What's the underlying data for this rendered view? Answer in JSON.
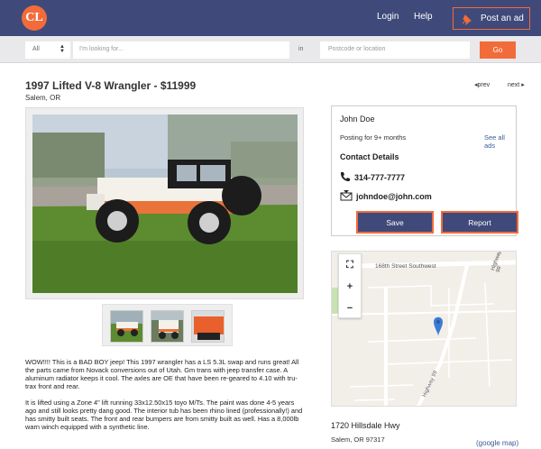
{
  "header": {
    "logo": "CL",
    "login": "Login",
    "help": "Help",
    "post_ad": "Post an ad"
  },
  "search": {
    "category": "All",
    "query_placeholder": "I'm looking for...",
    "in_label": "in",
    "location_placeholder": "Postcode or location",
    "go": "Go"
  },
  "listing": {
    "title": "1997 Lifted V-8 Wrangler - $11999",
    "location": "Salem, OR",
    "prev": "prev",
    "next": "next",
    "description_1": "WOW!!!! This is a BAD BOY jeep! This 1997 wrangler has a LS 5.3L swap and runs great! All the parts came from Novack conversions out of Utah. Gm trans with jeep transfer case. A aluminum radiator keeps it cool. The axles are OE that have been re-geared to 4.10 with tru-trax front and rear.",
    "description_2": "It is lifted using a Zone 4\" lift running 33x12.50x15 toyo M/Ts. The paint was done 4-5 years ago and still looks pretty dang good. The interior tub has been rhino lined (professionally!) and has smitty built seats. The front and rear bumpers are from smitty built as well. Has a 8,000lb warn winch equipped with a synthetic line."
  },
  "seller": {
    "name": "John Doe",
    "since": "Posting for 9+ months",
    "see_all": "See all ads",
    "contact_heading": "Contact Details",
    "phone": "314-777-7777",
    "email": "johndoe@john.com",
    "save": "Save",
    "report": "Report"
  },
  "map": {
    "street_1": "168th Street Southwest",
    "street_2": "Highway 99",
    "street_3": "Highway 99",
    "fullscreen": "⛶",
    "zoom_in": "+",
    "zoom_out": "−"
  },
  "address": {
    "line1": "1720 Hillsdale Hwy",
    "line2": "Salem, OR 97317",
    "google_map": "(google map)"
  },
  "colors": {
    "navy": "#3f4a7a",
    "accent": "#f26b3a",
    "link": "#3a5a9a"
  }
}
